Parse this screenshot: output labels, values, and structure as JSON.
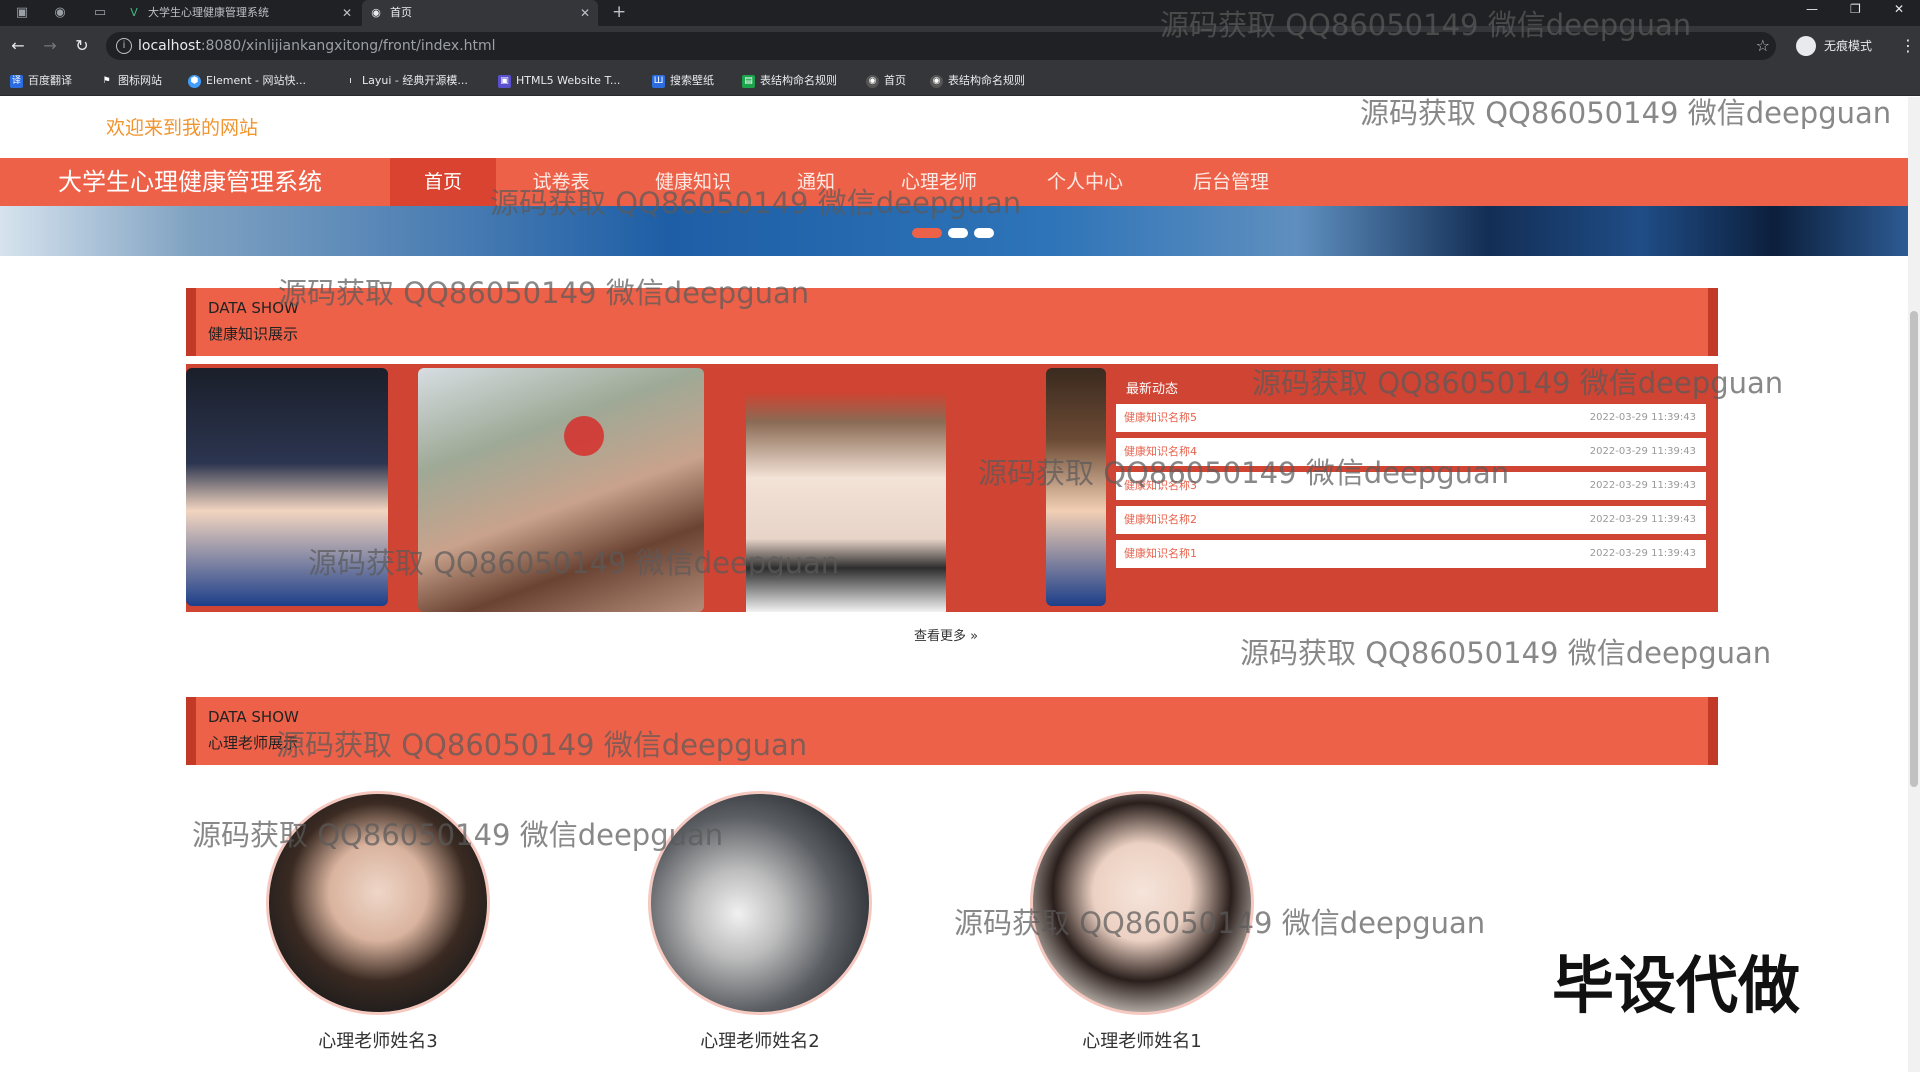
{
  "browser": {
    "tabs": [
      {
        "title": "大学生心理健康管理系统",
        "active": false
      },
      {
        "title": "首页",
        "active": true
      }
    ],
    "url_host": "localhost",
    "url_path": ":8080/xinlijiankangxitong/front/index.html",
    "incognito_label": "无痕模式",
    "bookmarks": [
      "百度翻译",
      "图标网站",
      "Element - 网站快...",
      "Layui - 经典开源模...",
      "HTML5 Website T...",
      "搜索壁纸",
      "表结构命名规则",
      "首页",
      "表结构命名规则"
    ]
  },
  "header": {
    "welcome": "欢迎来到我的网站",
    "brand": "大学生心理健康管理系统",
    "nav": [
      "首页",
      "试卷表",
      "健康知识",
      "通知",
      "心理老师",
      "个人中心",
      "后台管理"
    ],
    "active_nav_index": 0
  },
  "sections": {
    "knowledge": {
      "en": "DATA SHOW",
      "cn": "健康知识展示"
    },
    "teachers": {
      "en": "DATA SHOW",
      "cn": "心理老师展示"
    }
  },
  "news": {
    "title": "最新动态",
    "items": [
      {
        "name": "健康知识名称5",
        "date": "2022-03-29 11:39:43"
      },
      {
        "name": "健康知识名称4",
        "date": "2022-03-29 11:39:43"
      },
      {
        "name": "健康知识名称3",
        "date": "2022-03-29 11:39:43"
      },
      {
        "name": "健康知识名称2",
        "date": "2022-03-29 11:39:43"
      },
      {
        "name": "健康知识名称1",
        "date": "2022-03-29 11:39:43"
      }
    ],
    "more": "查看更多 »"
  },
  "teachers": [
    "心理老师姓名3",
    "心理老师姓名2",
    "心理老师姓名1"
  ],
  "overlay": {
    "watermark": "源码获取 QQ86050149 微信deepguan",
    "stamp": "毕设代做"
  },
  "colors": {
    "primary": "#ee6149",
    "primary_dark": "#d9432f",
    "welcome": "#f0952f"
  }
}
